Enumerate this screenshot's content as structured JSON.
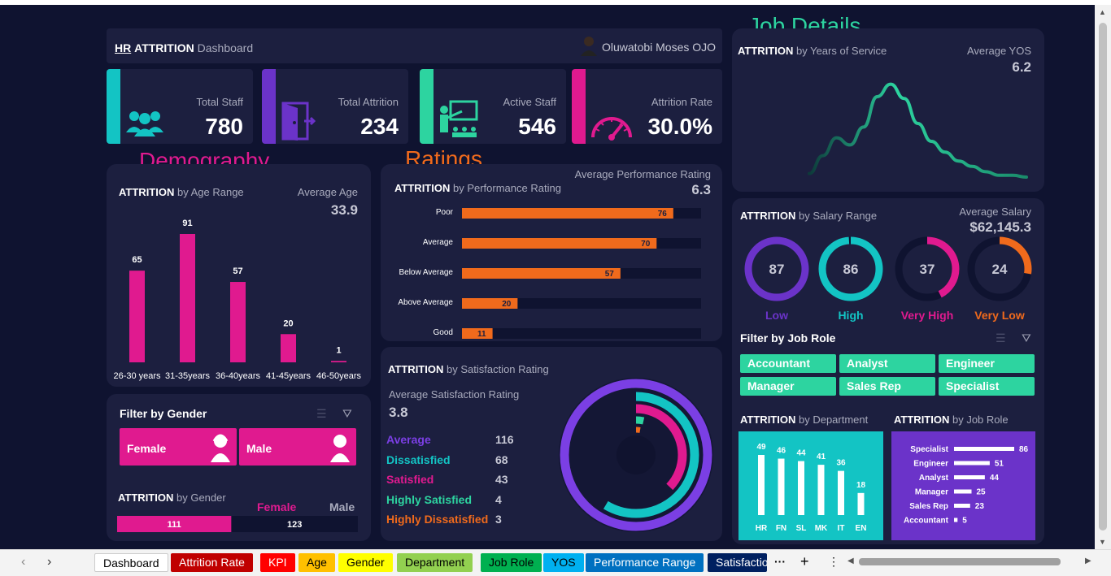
{
  "header": {
    "title_bold": "HR",
    "title_mid": "ATTRITION",
    "title_light": "Dashboard",
    "author": "Oluwatobi Moses OJO"
  },
  "sections": {
    "job_details": "Job Details",
    "demography": "Demography",
    "ratings": "Ratings"
  },
  "kpis": [
    {
      "label": "Total Staff",
      "value": "780",
      "color": "#13c4c4",
      "icon": "people-icon"
    },
    {
      "label": "Total Attrition",
      "value": "234",
      "color": "#6b33c9",
      "icon": "exit-door-icon"
    },
    {
      "label": "Active Staff",
      "value": "546",
      "color": "#2dd4a0",
      "icon": "presenter-icon"
    },
    {
      "label": "Attrition Rate",
      "value": "30.0%",
      "color": "#e01a8f",
      "icon": "gauge-icon"
    }
  ],
  "age": {
    "title_bold": "ATTRITION",
    "title_rest": "by Age Range",
    "avg_label": "Average Age",
    "avg_value": "33.9",
    "chart_data": {
      "type": "bar",
      "categories": [
        "26-30 years",
        "31-35years",
        "36-40years",
        "41-45years",
        "46-50years"
      ],
      "values": [
        65,
        91,
        57,
        20,
        1
      ],
      "ylim": [
        0,
        91
      ]
    }
  },
  "performance": {
    "title_bold": "ATTRITION",
    "title_rest": "by Performance Rating",
    "avg_label": "Average Performance Rating",
    "avg_value": "6.3",
    "chart_data": {
      "type": "bar",
      "categories": [
        "Poor",
        "Average",
        "Below Average",
        "Above Average",
        "Good"
      ],
      "values": [
        76,
        70,
        57,
        20,
        11
      ],
      "xlim": [
        0,
        86
      ]
    }
  },
  "yos": {
    "title_bold": "ATTRITION",
    "title_rest": "by Years of Service",
    "avg_label": "Average YOS",
    "avg_value": "6.2",
    "chart_data": {
      "type": "line",
      "values": [
        2,
        12,
        22,
        18,
        28,
        45,
        52,
        44,
        30,
        20,
        14,
        9,
        6,
        3,
        1,
        1,
        0
      ],
      "ylim": [
        0,
        55
      ]
    }
  },
  "salary": {
    "title_bold": "ATTRITION",
    "title_rest": "by Salary Range",
    "avg_label": "Average Salary",
    "avg_value": "$62,145.3",
    "chart_data": {
      "type": "pie",
      "categories": [
        "Low",
        "High",
        "Very High",
        "Very Low"
      ],
      "values": [
        87,
        86,
        37,
        24
      ],
      "colors": [
        "#6b33c9",
        "#13c4c4",
        "#e01a8f",
        "#f06a1c"
      ]
    }
  },
  "job_filter": {
    "title": "Filter by Job Role",
    "roles": [
      "Accountant",
      "Analyst",
      "Engineer",
      "Manager",
      "Sales Rep",
      "Specialist"
    ]
  },
  "department": {
    "title_bold": "ATTRITION",
    "title_rest": "by Department",
    "chart_data": {
      "type": "bar",
      "categories": [
        "HR",
        "FN",
        "SL",
        "MK",
        "IT",
        "EN"
      ],
      "values": [
        49,
        46,
        44,
        41,
        36,
        18
      ],
      "ylim": [
        0,
        49
      ]
    }
  },
  "job_role": {
    "title_bold": "ATTRITION",
    "title_rest": "by Job Role",
    "chart_data": {
      "type": "bar",
      "categories": [
        "Specialist",
        "Engineer",
        "Analyst",
        "Manager",
        "Sales Rep",
        "Accountant"
      ],
      "values": [
        86,
        51,
        44,
        25,
        23,
        5
      ],
      "xlim": [
        0,
        86
      ]
    }
  },
  "gender_filter": {
    "title": "Filter by Gender",
    "female": "Female",
    "male": "Male"
  },
  "gender": {
    "title_bold": "ATTRITION",
    "title_rest": "by Gender",
    "female_label": "Female",
    "male_label": "Male",
    "chart_data": {
      "type": "bar",
      "categories": [
        "Female",
        "Male"
      ],
      "values": [
        111,
        123
      ]
    }
  },
  "satisfaction": {
    "title_bold": "ATTRITION",
    "title_rest": "by Satisfaction Rating",
    "avg_label": "Average Satisfaction Rating",
    "avg_value": "3.8",
    "chart_data": {
      "type": "pie",
      "categories": [
        "Average",
        "Dissatisfied",
        "Satisfied",
        "Highly Satisfied",
        "Highly Dissatisfied"
      ],
      "values": [
        116,
        68,
        43,
        4,
        3
      ],
      "colors": [
        "#7b3fe4",
        "#13c4c4",
        "#e01a8f",
        "#2dd4a0",
        "#f06a1c"
      ]
    }
  },
  "tabs": [
    {
      "label": "Dashboard",
      "color": "#ffffff"
    },
    {
      "label": "Attrition Rate",
      "color": "#c00000"
    },
    {
      "label": "KPI",
      "color": "#ff0000"
    },
    {
      "label": "Age",
      "color": "#ffc000"
    },
    {
      "label": "Gender",
      "color": "#ffff00"
    },
    {
      "label": "Department",
      "color": "#92d050"
    },
    {
      "label": "Job Role",
      "color": "#00b050"
    },
    {
      "label": "YOS",
      "color": "#00b0f0"
    },
    {
      "label": "Performance Range",
      "color": "#0070c0"
    },
    {
      "label": "Satisfactio",
      "color": "#002060"
    }
  ]
}
